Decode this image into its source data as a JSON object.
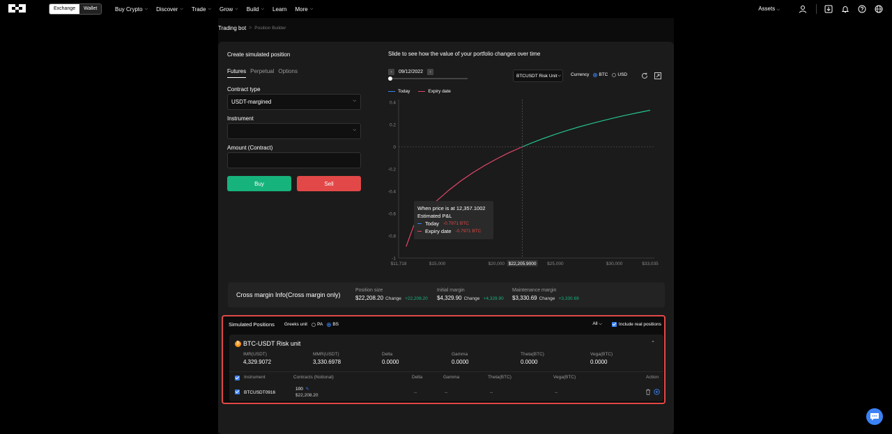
{
  "nav": {
    "switch": [
      "Exchange",
      "Wallet"
    ],
    "menu": [
      "Buy Crypto",
      "Discover",
      "Trade",
      "Grow",
      "Build",
      "Learn",
      "More"
    ],
    "assets": "Assets"
  },
  "breadcrumb": {
    "root": "Trading bot",
    "sep": ">",
    "current": "Position Builder"
  },
  "left": {
    "title": "Create simulated position",
    "tabs": [
      "Futures",
      "Perpetual",
      "Options"
    ],
    "contract_type_label": "Contract type",
    "contract_type_value": "USDT-margined",
    "instrument_label": "Instrument",
    "instrument_value": "",
    "amount_label": "Amount (Contract)",
    "amount_value": "",
    "buy": "Buy",
    "sell": "Sell"
  },
  "chart_panel": {
    "title": "Slide to see how the value of your portfolio changes over time",
    "date": "09/12/2022",
    "risk_unit": "BTCUSDT Risk Unit",
    "currency_label": "Currency",
    "currency_options": [
      "BTC",
      "USD"
    ],
    "legend": [
      "Today",
      "Expiry date"
    ],
    "tooltip": {
      "line1": "When price is at 12,357.1002",
      "line2": "Estimated P&L",
      "today_label": "Today",
      "today_value": "-0.7971 BTC",
      "expiry_label": "Expiry date",
      "expiry_value": "-0.7971 BTC"
    },
    "current_price": "$22,205.9000"
  },
  "chart_data": {
    "type": "line",
    "xlabel": "",
    "ylabel": "",
    "x_ticks": [
      "$11,718",
      "$15,000",
      "$20,000",
      "$25,000",
      "$30,000",
      "$33,035"
    ],
    "y_ticks": [
      "0.4",
      "0.2",
      "0",
      "-0.2",
      "-0.4",
      "-0.6",
      "-0.8",
      "-1"
    ],
    "xlim": [
      11718,
      33035
    ],
    "ylim": [
      -1,
      0.4
    ],
    "marker_x": 22205.9,
    "series": [
      {
        "name": "Expiry date",
        "x": [
          12357,
          13000,
          14000,
          15000,
          16000,
          17000,
          18000,
          19000,
          20000,
          21000,
          22206,
          23000,
          24000,
          25000,
          26000,
          27000,
          28000,
          29000,
          30000,
          31000,
          32000,
          33035
        ],
        "y": [
          -0.897,
          -0.708,
          -0.586,
          -0.48,
          -0.388,
          -0.306,
          -0.234,
          -0.169,
          -0.11,
          -0.057,
          0.0,
          0.035,
          0.075,
          0.112,
          0.146,
          0.178,
          0.207,
          0.234,
          0.26,
          0.284,
          0.306,
          0.328
        ]
      }
    ],
    "colors": {
      "today": "#3b82f6",
      "expiry_negative": "#e2486a",
      "expiry_positive": "#26c48c"
    }
  },
  "cross": {
    "title": "Cross margin Info(Cross margin only)",
    "cols": [
      {
        "h": "Position size",
        "v": "$22,208.20",
        "chg_label": "Change",
        "chg": "+22,208.20"
      },
      {
        "h": "Initial margin",
        "v": "$4,329.90",
        "chg_label": "Change",
        "chg": "+4,329.90"
      },
      {
        "h": "Maintenance margin",
        "v": "$3,330.69",
        "chg_label": "Change",
        "chg": "+3,330.69"
      }
    ]
  },
  "sim": {
    "title": "Simulated Positions",
    "greeks_label": "Greeks unit",
    "greeks_options": [
      "PA",
      "BS"
    ],
    "filter": "All",
    "include_real": "Include real positions",
    "unit_title": "BTC-USDT Risk unit",
    "metrics": [
      {
        "h": "IMR(USDT)",
        "v": "4,329.9072"
      },
      {
        "h": "MMR(USDT)",
        "v": "3,330.6978"
      },
      {
        "h": "Delta",
        "v": "0.0000"
      },
      {
        "h": "Gamma",
        "v": "0.0000"
      },
      {
        "h": "Theta(BTC)",
        "v": "0.0000"
      },
      {
        "h": "Vega(BTC)",
        "v": "0.0000"
      }
    ],
    "headers": [
      "Instrument",
      "Contracts (Notional)",
      "Delta",
      "Gamma",
      "Theta(BTC)",
      "Vega(BTC)",
      "Action"
    ],
    "row": {
      "instrument": "BTCUSDT0916",
      "contracts": "100",
      "notional": "$22,208.20",
      "delta": "--",
      "gamma": "--",
      "theta": "--",
      "vega": "--"
    }
  }
}
